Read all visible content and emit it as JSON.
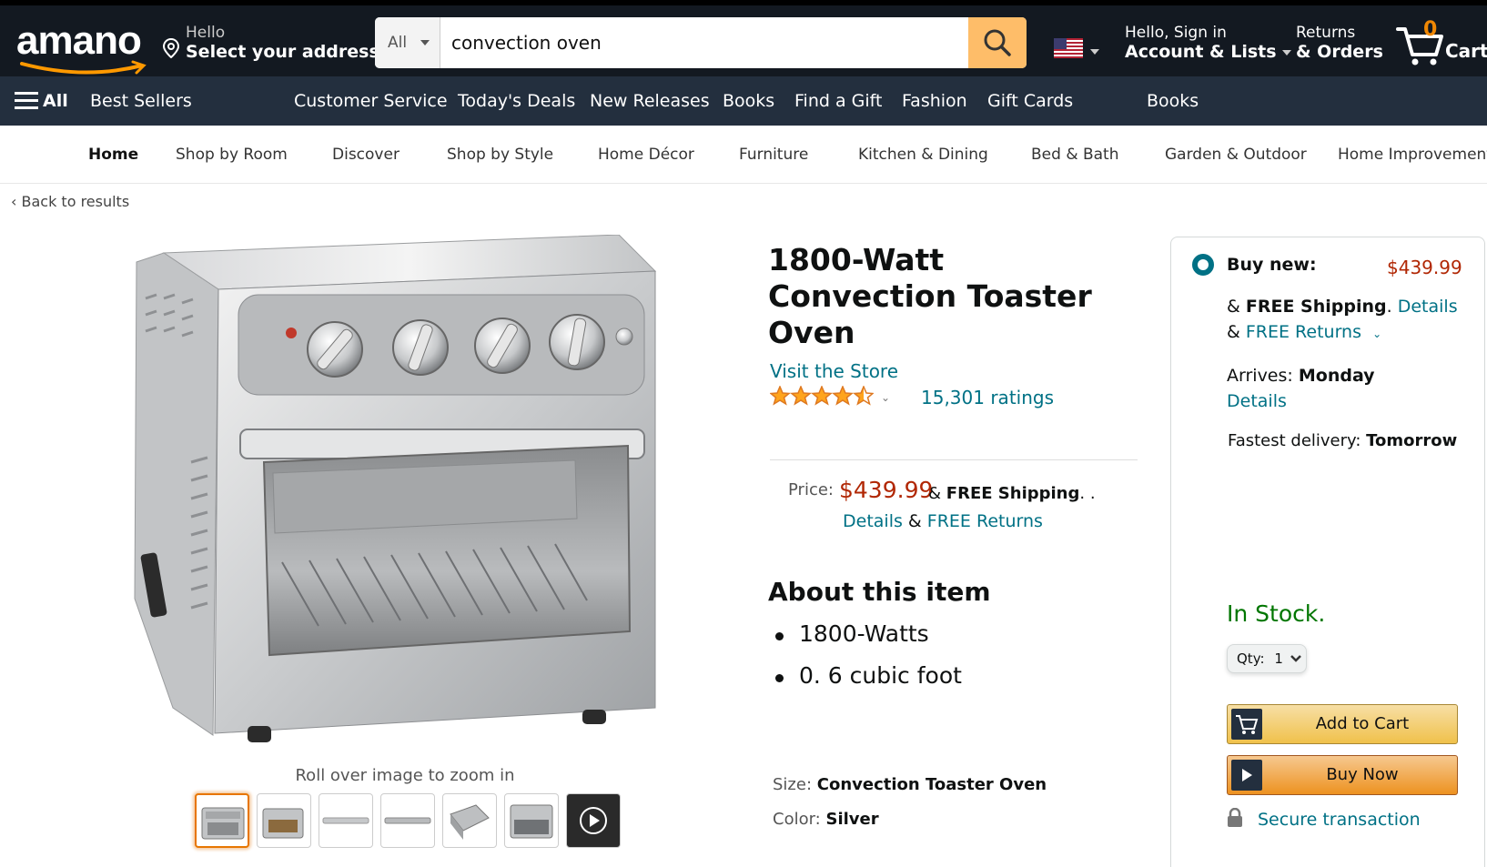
{
  "header": {
    "logo_text": "amano",
    "address_line1": "Hello",
    "address_line2": "Select your address",
    "search_category": "All",
    "search_value": "convection oven",
    "account_line1": "Hello, Sign in",
    "account_line2": "Account & Lists",
    "orders_line1": "Returns",
    "orders_line2": "& Orders",
    "cart_count": "0",
    "cart_label": "Cart"
  },
  "subnav": {
    "all_label": "All",
    "items": [
      "Best Sellers",
      "Customer Service",
      "Today's Deals",
      "New Releases",
      "Books",
      "Find a Gift",
      "Fashion",
      "Gift Cards",
      "Books"
    ]
  },
  "deptnav": {
    "items": [
      "Home",
      "Shop by Room",
      "Discover",
      "Shop by Style",
      "Home Décor",
      "Furniture",
      "Kitchen & Dining",
      "Bed & Bath",
      "Garden & Outdoor",
      "Home Improvement"
    ]
  },
  "back_link": "‹  Back to results",
  "gallery": {
    "zoom_hint": "Roll over image to zoom in",
    "thumbnail_count": 7
  },
  "product": {
    "title_line1": "1800-Watt",
    "title_line2": "Convection Toaster Oven",
    "store_link": "Visit the Store",
    "rating": 4.5,
    "ratings_count": "15,301 ratings",
    "price_label": "Price:",
    "price": "$439.99",
    "price_amp": "&",
    "price_shipping": "FREE Shipping",
    "price_shipping_suffix": ". .",
    "details_link": "Details",
    "details_amp": "&",
    "returns_link": "FREE Returns",
    "about_heading": "About this item",
    "bullets": [
      "1800-Watts",
      "0. 6 cubic foot"
    ],
    "size_label": "Size:",
    "size_value": "Convection Toaster Oven",
    "color_label": "Color:",
    "color_value": "Silver"
  },
  "buybox": {
    "buy_new_label": "Buy new:",
    "price": "$439.99",
    "ship_prefix": "&",
    "ship_bold": "FREE Shipping",
    "ship_dot": ".",
    "ship_details": "Details",
    "returns_prefix": "&",
    "returns_link": "FREE Returns",
    "arrives_label": "Arrives:",
    "arrives_day": "Monday",
    "arrives_details": "Details",
    "fastest_label": "Fastest delivery:",
    "fastest_day": "Tomorrow",
    "stock": "In Stock.",
    "qty_label": "Qty:",
    "qty_value": "1",
    "add_to_cart": "Add to Cart",
    "buy_now": "Buy Now",
    "secure": "Secure transaction"
  },
  "colors": {
    "nav_dark": "#131921",
    "nav_secondary": "#232F3E",
    "search_button": "#FEBD69",
    "price_red": "#B12704",
    "link_teal": "#007185",
    "stock_green": "#007600",
    "star_orange": "#FFA41C"
  }
}
